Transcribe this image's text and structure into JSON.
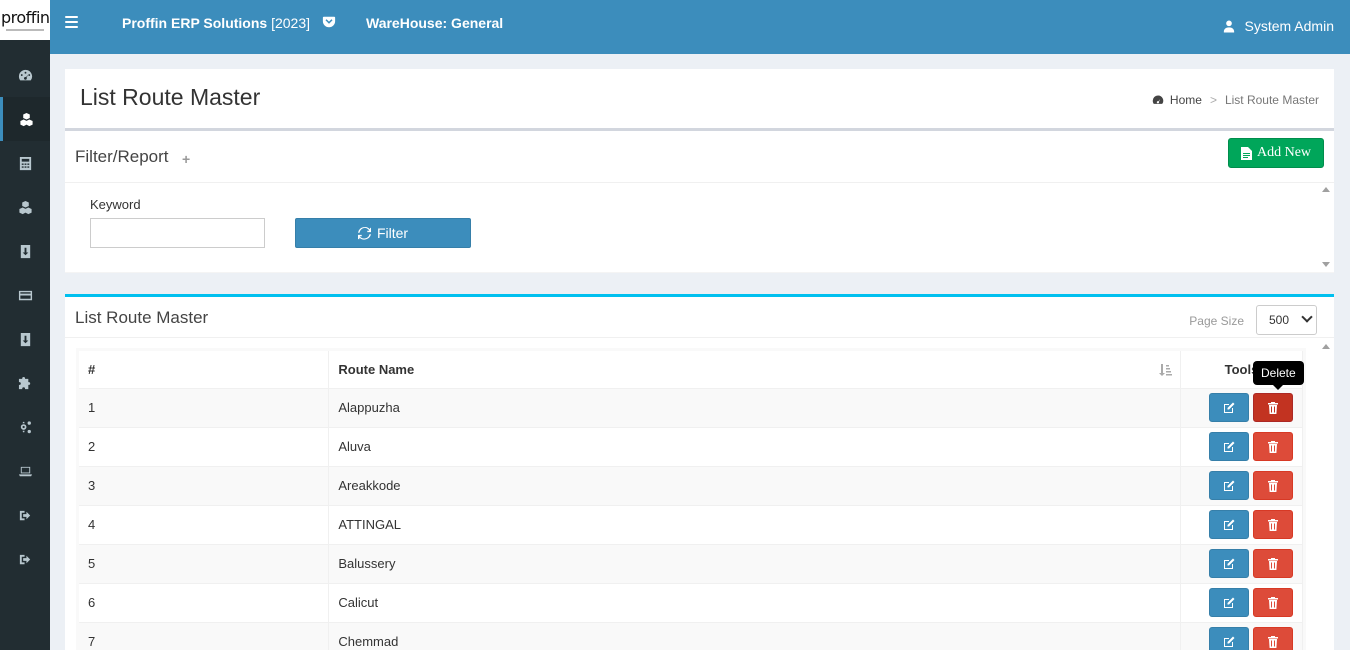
{
  "brand": {
    "logo_text": "proffin"
  },
  "header": {
    "app_title": "Proffin ERP Solutions",
    "app_year": "[2023]",
    "warehouse": "WareHouse: General",
    "user": "System Admin"
  },
  "sidebar": {
    "items": [
      {
        "icon": "dashboard-icon"
      },
      {
        "icon": "cubes-icon",
        "active": true
      },
      {
        "icon": "calculator-icon"
      },
      {
        "icon": "cubes-icon"
      },
      {
        "icon": "file-icon"
      },
      {
        "icon": "credit-card-icon"
      },
      {
        "icon": "file-icon"
      },
      {
        "icon": "puzzle-icon"
      },
      {
        "icon": "gears-icon"
      },
      {
        "icon": "laptop-icon"
      },
      {
        "icon": "sign-out-icon"
      },
      {
        "icon": "sign-out-icon"
      }
    ]
  },
  "page": {
    "title": "List Route Master",
    "breadcrumb": {
      "home": "Home",
      "separator": ">",
      "current": "List Route Master"
    }
  },
  "filter": {
    "title": "Filter/Report",
    "plus": "+",
    "add_new_label": "Add New",
    "keyword_label": "Keyword",
    "keyword_value": "",
    "filter_label": "Filter"
  },
  "list": {
    "title": "List Route Master",
    "page_size_label": "Page Size",
    "page_size_value": "500",
    "columns": {
      "num": "#",
      "route": "Route Name",
      "tools": "Tools"
    },
    "rows": [
      {
        "num": "1",
        "route": "Alappuzha"
      },
      {
        "num": "2",
        "route": "Aluva"
      },
      {
        "num": "3",
        "route": "Areakkode"
      },
      {
        "num": "4",
        "route": "ATTINGAL"
      },
      {
        "num": "5",
        "route": "Balussery"
      },
      {
        "num": "6",
        "route": "Calicut"
      },
      {
        "num": "7",
        "route": "Chemmad"
      }
    ]
  },
  "tooltip": {
    "text": "Delete"
  },
  "colors": {
    "primary": "#3c8dbc",
    "success": "#00a65a",
    "danger": "#dd4b39",
    "sidebar": "#222d32",
    "info": "#00c0ef"
  }
}
